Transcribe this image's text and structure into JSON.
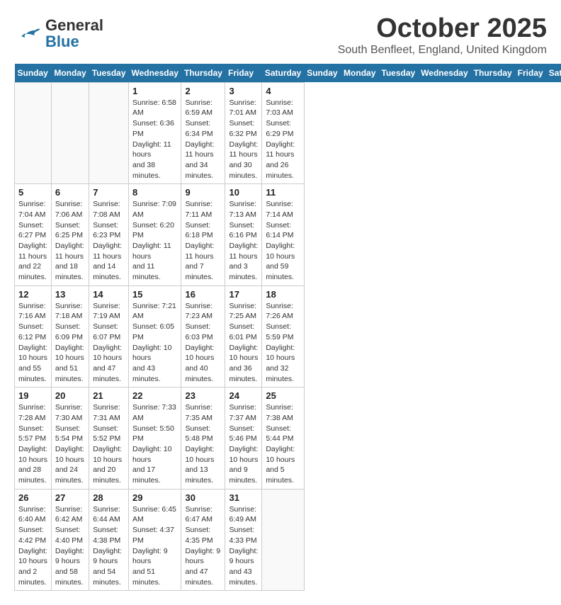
{
  "header": {
    "logo_general": "General",
    "logo_blue": "Blue",
    "title": "October 2025",
    "subtitle": "South Benfleet, England, United Kingdom"
  },
  "days_of_week": [
    "Sunday",
    "Monday",
    "Tuesday",
    "Wednesday",
    "Thursday",
    "Friday",
    "Saturday"
  ],
  "weeks": [
    [
      {
        "day": "",
        "info": ""
      },
      {
        "day": "",
        "info": ""
      },
      {
        "day": "",
        "info": ""
      },
      {
        "day": "1",
        "info": "Sunrise: 6:58 AM\nSunset: 6:36 PM\nDaylight: 11 hours\nand 38 minutes."
      },
      {
        "day": "2",
        "info": "Sunrise: 6:59 AM\nSunset: 6:34 PM\nDaylight: 11 hours\nand 34 minutes."
      },
      {
        "day": "3",
        "info": "Sunrise: 7:01 AM\nSunset: 6:32 PM\nDaylight: 11 hours\nand 30 minutes."
      },
      {
        "day": "4",
        "info": "Sunrise: 7:03 AM\nSunset: 6:29 PM\nDaylight: 11 hours\nand 26 minutes."
      }
    ],
    [
      {
        "day": "5",
        "info": "Sunrise: 7:04 AM\nSunset: 6:27 PM\nDaylight: 11 hours\nand 22 minutes."
      },
      {
        "day": "6",
        "info": "Sunrise: 7:06 AM\nSunset: 6:25 PM\nDaylight: 11 hours\nand 18 minutes."
      },
      {
        "day": "7",
        "info": "Sunrise: 7:08 AM\nSunset: 6:23 PM\nDaylight: 11 hours\nand 14 minutes."
      },
      {
        "day": "8",
        "info": "Sunrise: 7:09 AM\nSunset: 6:20 PM\nDaylight: 11 hours\nand 11 minutes."
      },
      {
        "day": "9",
        "info": "Sunrise: 7:11 AM\nSunset: 6:18 PM\nDaylight: 11 hours\nand 7 minutes."
      },
      {
        "day": "10",
        "info": "Sunrise: 7:13 AM\nSunset: 6:16 PM\nDaylight: 11 hours\nand 3 minutes."
      },
      {
        "day": "11",
        "info": "Sunrise: 7:14 AM\nSunset: 6:14 PM\nDaylight: 10 hours\nand 59 minutes."
      }
    ],
    [
      {
        "day": "12",
        "info": "Sunrise: 7:16 AM\nSunset: 6:12 PM\nDaylight: 10 hours\nand 55 minutes."
      },
      {
        "day": "13",
        "info": "Sunrise: 7:18 AM\nSunset: 6:09 PM\nDaylight: 10 hours\nand 51 minutes."
      },
      {
        "day": "14",
        "info": "Sunrise: 7:19 AM\nSunset: 6:07 PM\nDaylight: 10 hours\nand 47 minutes."
      },
      {
        "day": "15",
        "info": "Sunrise: 7:21 AM\nSunset: 6:05 PM\nDaylight: 10 hours\nand 43 minutes."
      },
      {
        "day": "16",
        "info": "Sunrise: 7:23 AM\nSunset: 6:03 PM\nDaylight: 10 hours\nand 40 minutes."
      },
      {
        "day": "17",
        "info": "Sunrise: 7:25 AM\nSunset: 6:01 PM\nDaylight: 10 hours\nand 36 minutes."
      },
      {
        "day": "18",
        "info": "Sunrise: 7:26 AM\nSunset: 5:59 PM\nDaylight: 10 hours\nand 32 minutes."
      }
    ],
    [
      {
        "day": "19",
        "info": "Sunrise: 7:28 AM\nSunset: 5:57 PM\nDaylight: 10 hours\nand 28 minutes."
      },
      {
        "day": "20",
        "info": "Sunrise: 7:30 AM\nSunset: 5:54 PM\nDaylight: 10 hours\nand 24 minutes."
      },
      {
        "day": "21",
        "info": "Sunrise: 7:31 AM\nSunset: 5:52 PM\nDaylight: 10 hours\nand 20 minutes."
      },
      {
        "day": "22",
        "info": "Sunrise: 7:33 AM\nSunset: 5:50 PM\nDaylight: 10 hours\nand 17 minutes."
      },
      {
        "day": "23",
        "info": "Sunrise: 7:35 AM\nSunset: 5:48 PM\nDaylight: 10 hours\nand 13 minutes."
      },
      {
        "day": "24",
        "info": "Sunrise: 7:37 AM\nSunset: 5:46 PM\nDaylight: 10 hours\nand 9 minutes."
      },
      {
        "day": "25",
        "info": "Sunrise: 7:38 AM\nSunset: 5:44 PM\nDaylight: 10 hours\nand 5 minutes."
      }
    ],
    [
      {
        "day": "26",
        "info": "Sunrise: 6:40 AM\nSunset: 4:42 PM\nDaylight: 10 hours\nand 2 minutes."
      },
      {
        "day": "27",
        "info": "Sunrise: 6:42 AM\nSunset: 4:40 PM\nDaylight: 9 hours\nand 58 minutes."
      },
      {
        "day": "28",
        "info": "Sunrise: 6:44 AM\nSunset: 4:38 PM\nDaylight: 9 hours\nand 54 minutes."
      },
      {
        "day": "29",
        "info": "Sunrise: 6:45 AM\nSunset: 4:37 PM\nDaylight: 9 hours\nand 51 minutes."
      },
      {
        "day": "30",
        "info": "Sunrise: 6:47 AM\nSunset: 4:35 PM\nDaylight: 9 hours\nand 47 minutes."
      },
      {
        "day": "31",
        "info": "Sunrise: 6:49 AM\nSunset: 4:33 PM\nDaylight: 9 hours\nand 43 minutes."
      },
      {
        "day": "",
        "info": ""
      }
    ]
  ]
}
